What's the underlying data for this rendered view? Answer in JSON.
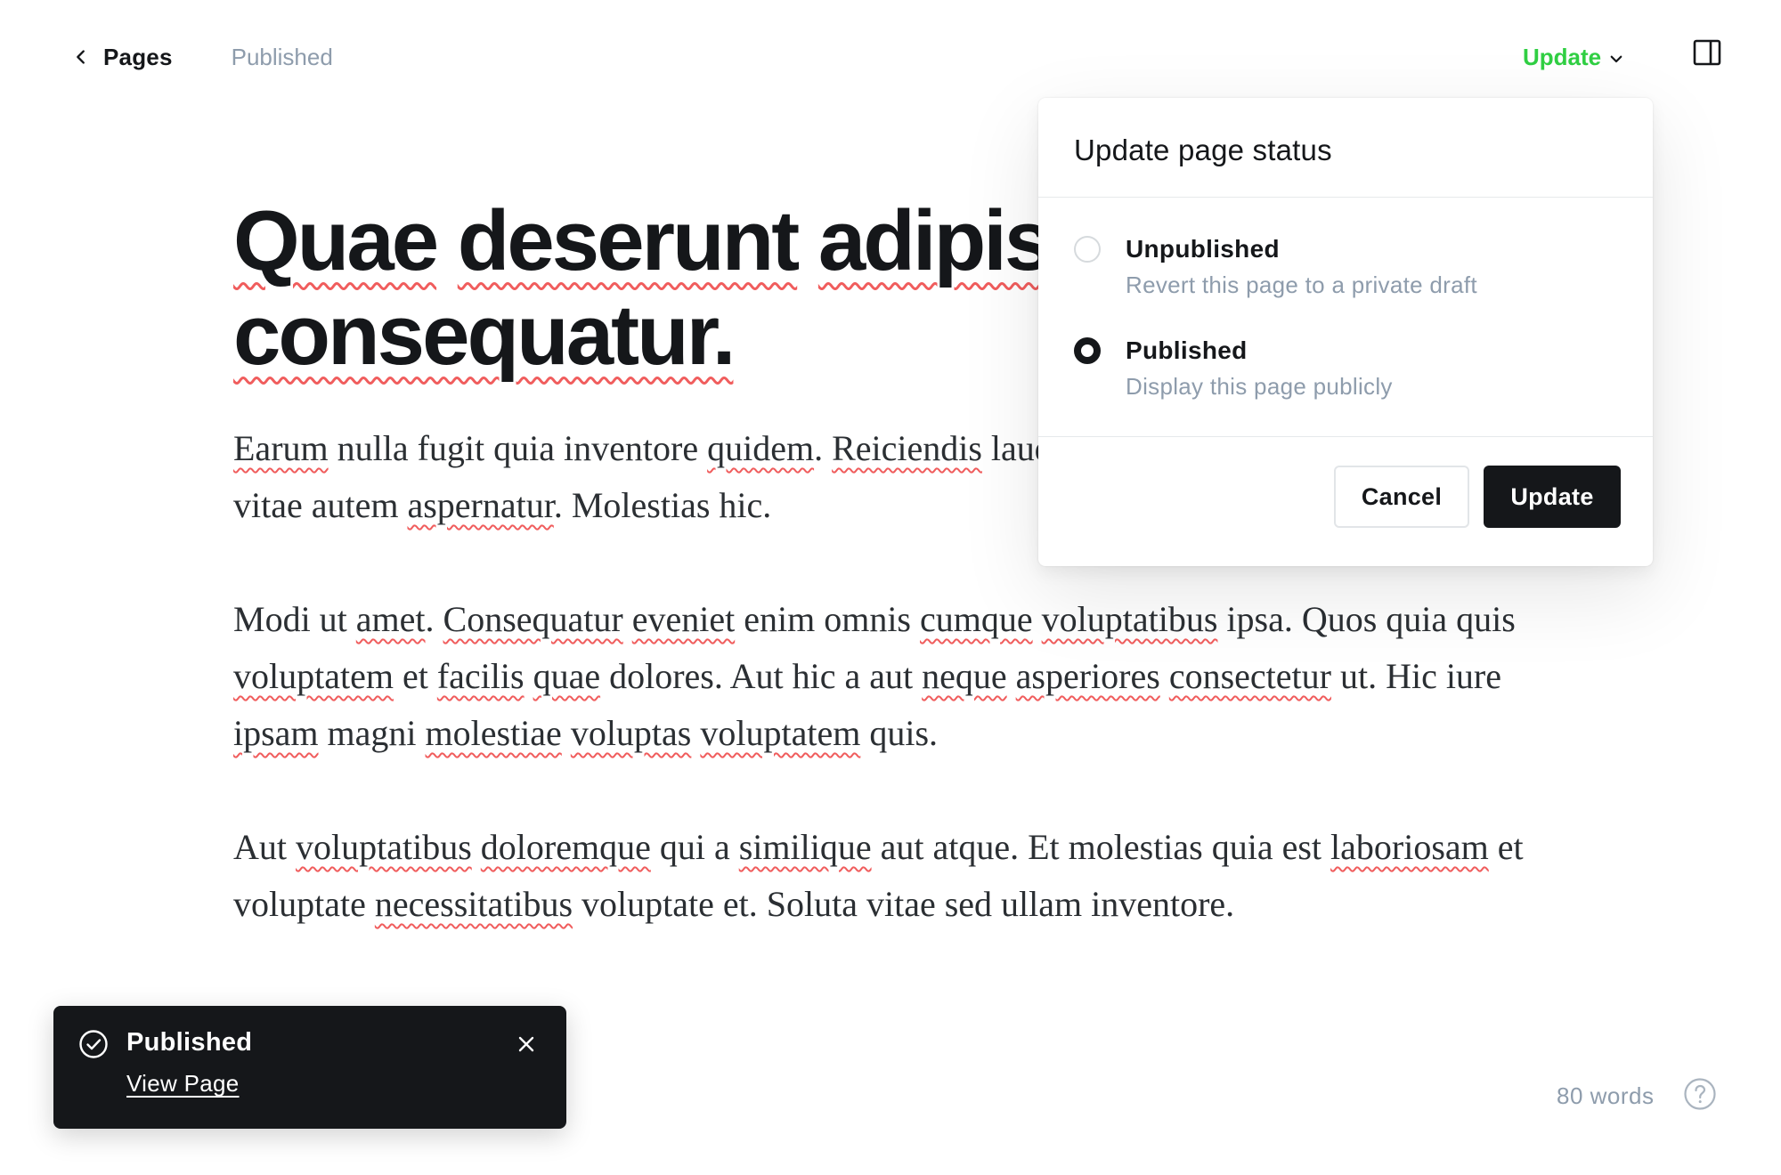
{
  "header": {
    "back_label": "Pages",
    "status": "Published",
    "update_label": "Update"
  },
  "editor": {
    "title": [
      [
        {
          "t": "Quae",
          "s": true
        },
        {
          "t": " "
        },
        {
          "t": "deserunt",
          "s": true
        },
        {
          "t": " "
        },
        {
          "t": "adipisci",
          "s": true
        },
        {
          "t": " "
        },
        {
          "t": "consequatur.",
          "s": true
        }
      ]
    ],
    "paragraphs": [
      [
        {
          "t": "Earum",
          "s": true
        },
        {
          "t": " nulla fugit quia inventore "
        },
        {
          "t": "quidem",
          "s": true
        },
        {
          "t": ". "
        },
        {
          "t": "Reiciendis",
          "s": true
        },
        {
          "t": " laudantium quisquam ipsa. Eos non vitae autem "
        },
        {
          "t": "aspernatur",
          "s": true
        },
        {
          "t": ". Molestias hic."
        }
      ],
      [
        {
          "t": "Modi ut "
        },
        {
          "t": "amet",
          "s": true
        },
        {
          "t": ". "
        },
        {
          "t": "Consequatur",
          "s": true
        },
        {
          "t": " "
        },
        {
          "t": "eveniet",
          "s": true
        },
        {
          "t": " enim omnis "
        },
        {
          "t": "cumque",
          "s": true
        },
        {
          "t": " "
        },
        {
          "t": "voluptatibus",
          "s": true
        },
        {
          "t": " ipsa. Quos quia quis "
        },
        {
          "t": "voluptatem",
          "s": true
        },
        {
          "t": " et "
        },
        {
          "t": "facilis",
          "s": true
        },
        {
          "t": " "
        },
        {
          "t": "quae",
          "s": true
        },
        {
          "t": " dolores. Aut hic a aut "
        },
        {
          "t": "neque",
          "s": true
        },
        {
          "t": " "
        },
        {
          "t": "asperiores",
          "s": true
        },
        {
          "t": " "
        },
        {
          "t": "consectetur",
          "s": true
        },
        {
          "t": " ut. Hic iure "
        },
        {
          "t": "ipsam",
          "s": true
        },
        {
          "t": " magni "
        },
        {
          "t": "molestiae",
          "s": true
        },
        {
          "t": " "
        },
        {
          "t": "voluptas",
          "s": true
        },
        {
          "t": " "
        },
        {
          "t": "voluptatem",
          "s": true
        },
        {
          "t": " quis."
        }
      ],
      [
        {
          "t": "Aut "
        },
        {
          "t": "voluptatibus",
          "s": true
        },
        {
          "t": " "
        },
        {
          "t": "doloremque",
          "s": true
        },
        {
          "t": " qui a "
        },
        {
          "t": "similique",
          "s": true
        },
        {
          "t": " aut atque. Et molestias quia est "
        },
        {
          "t": "laboriosam",
          "s": true
        },
        {
          "t": " et voluptate "
        },
        {
          "t": "necessitatibus",
          "s": true
        },
        {
          "t": " voluptate et. Soluta vitae sed ullam inventore."
        }
      ]
    ]
  },
  "popover": {
    "title": "Update page status",
    "options": [
      {
        "label": "Unpublished",
        "description": "Revert this page to a private draft",
        "checked": false
      },
      {
        "label": "Published",
        "description": "Display this page publicly",
        "checked": true
      }
    ],
    "cancel_label": "Cancel",
    "update_label": "Update"
  },
  "toast": {
    "title": "Published",
    "link": "View Page"
  },
  "footer": {
    "word_count": "80 words"
  },
  "icons": {
    "back": "chevron-left-icon",
    "dropdown": "chevron-down-icon",
    "sidebar": "sidebar-panel-icon",
    "toast_check": "check-circle-icon",
    "toast_close": "close-icon",
    "help": "question-circle-icon"
  },
  "colors": {
    "accent_green": "#30cf43",
    "ink": "#15171a",
    "muted": "#8e9cac",
    "spellcheck": "#f05d5d"
  }
}
